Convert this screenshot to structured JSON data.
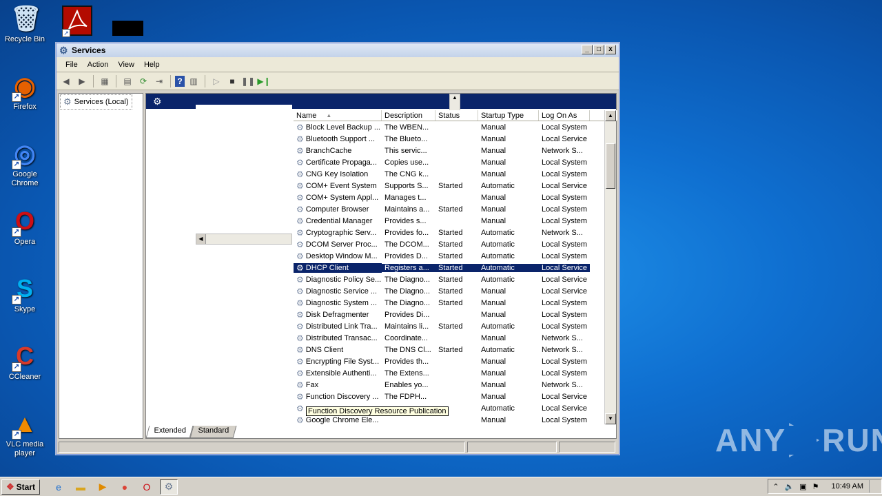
{
  "desktop": {
    "icons": [
      {
        "label": "Recycle Bin",
        "icon": "recycle-bin-icon",
        "color": "#cfe3f5"
      },
      {
        "label": "Firefox",
        "icon": "firefox-icon",
        "color": "#e66000"
      },
      {
        "label": "Google Chrome",
        "icon": "chrome-icon",
        "color": "#4285f4"
      },
      {
        "label": "Opera",
        "icon": "opera-icon",
        "color": "#cc0f16"
      },
      {
        "label": "Skype",
        "icon": "skype-icon",
        "color": "#00aff0"
      },
      {
        "label": "CCleaner",
        "icon": "ccleaner-icon",
        "color": "#d73a2b"
      },
      {
        "label": "VLC media player",
        "icon": "vlc-icon",
        "color": "#f08a00"
      }
    ],
    "top_icons": [
      {
        "icon": "acrobat-icon"
      },
      {
        "icon": "black-tile-icon"
      }
    ]
  },
  "window": {
    "title": "Services",
    "controls": {
      "minimize": "_",
      "maximize": "□",
      "close": "x"
    },
    "menu": [
      "File",
      "Action",
      "View",
      "Help"
    ],
    "tree": {
      "root": "Services (Local)"
    },
    "columns": [
      "Name",
      "Description",
      "Status",
      "Startup Type",
      "Log On As"
    ],
    "rows": [
      [
        "Block Level Backup ...",
        "The WBEN...",
        "",
        "Manual",
        "Local System"
      ],
      [
        "Bluetooth Support ...",
        "The Blueto...",
        "",
        "Manual",
        "Local Service"
      ],
      [
        "BranchCache",
        "This servic...",
        "",
        "Manual",
        "Network S..."
      ],
      [
        "Certificate Propaga...",
        "Copies use...",
        "",
        "Manual",
        "Local System"
      ],
      [
        "CNG Key Isolation",
        "The CNG k...",
        "",
        "Manual",
        "Local System"
      ],
      [
        "COM+ Event System",
        "Supports S...",
        "Started",
        "Automatic",
        "Local Service"
      ],
      [
        "COM+ System Appl...",
        "Manages t...",
        "",
        "Manual",
        "Local System"
      ],
      [
        "Computer Browser",
        "Maintains a...",
        "Started",
        "Manual",
        "Local System"
      ],
      [
        "Credential Manager",
        "Provides s...",
        "",
        "Manual",
        "Local System"
      ],
      [
        "Cryptographic Serv...",
        "Provides fo...",
        "Started",
        "Automatic",
        "Network S..."
      ],
      [
        "DCOM Server Proc...",
        "The DCOM...",
        "Started",
        "Automatic",
        "Local System"
      ],
      [
        "Desktop Window M...",
        "Provides D...",
        "Started",
        "Automatic",
        "Local System"
      ],
      [
        "DHCP Client",
        "Registers a...",
        "Started",
        "Automatic",
        "Local Service"
      ],
      [
        "Diagnostic Policy Se...",
        "The Diagno...",
        "Started",
        "Automatic",
        "Local Service"
      ],
      [
        "Diagnostic Service ...",
        "The Diagno...",
        "Started",
        "Manual",
        "Local Service"
      ],
      [
        "Diagnostic System ...",
        "The Diagno...",
        "Started",
        "Manual",
        "Local System"
      ],
      [
        "Disk Defragmenter",
        "Provides Di...",
        "",
        "Manual",
        "Local System"
      ],
      [
        "Distributed Link Tra...",
        "Maintains li...",
        "Started",
        "Automatic",
        "Local System"
      ],
      [
        "Distributed Transac...",
        "Coordinate...",
        "",
        "Manual",
        "Network S..."
      ],
      [
        "DNS Client",
        "The DNS Cl...",
        "Started",
        "Automatic",
        "Network S..."
      ],
      [
        "Encrypting File Syst...",
        "Provides th...",
        "",
        "Manual",
        "Local System"
      ],
      [
        "Extensible Authenti...",
        "The Extens...",
        "",
        "Manual",
        "Local System"
      ],
      [
        "Fax",
        "Enables yo...",
        "",
        "Manual",
        "Network S..."
      ],
      [
        "Function Discovery ...",
        "The FDPH...",
        "",
        "Manual",
        "Local Service"
      ],
      [
        "",
        "",
        "",
        "Automatic",
        "Local Service"
      ],
      [
        "Google Chrome Ele...",
        "",
        "",
        "Manual",
        "Local System"
      ]
    ],
    "selected_row": 12,
    "tooltip": "Function Discovery Resource Publication",
    "tabs": [
      "Extended",
      "Standard"
    ]
  },
  "taskbar": {
    "start": "Start",
    "clock": "10:49 AM",
    "apps": [
      "ie-icon",
      "explorer-icon",
      "media-player-icon",
      "chrome-icon",
      "opera-icon",
      "services-icon"
    ]
  },
  "watermark": {
    "left": "ANY",
    "right": "RUN"
  },
  "colors": {
    "selection": "#0a246a",
    "desktop": "#0f6fd0"
  }
}
